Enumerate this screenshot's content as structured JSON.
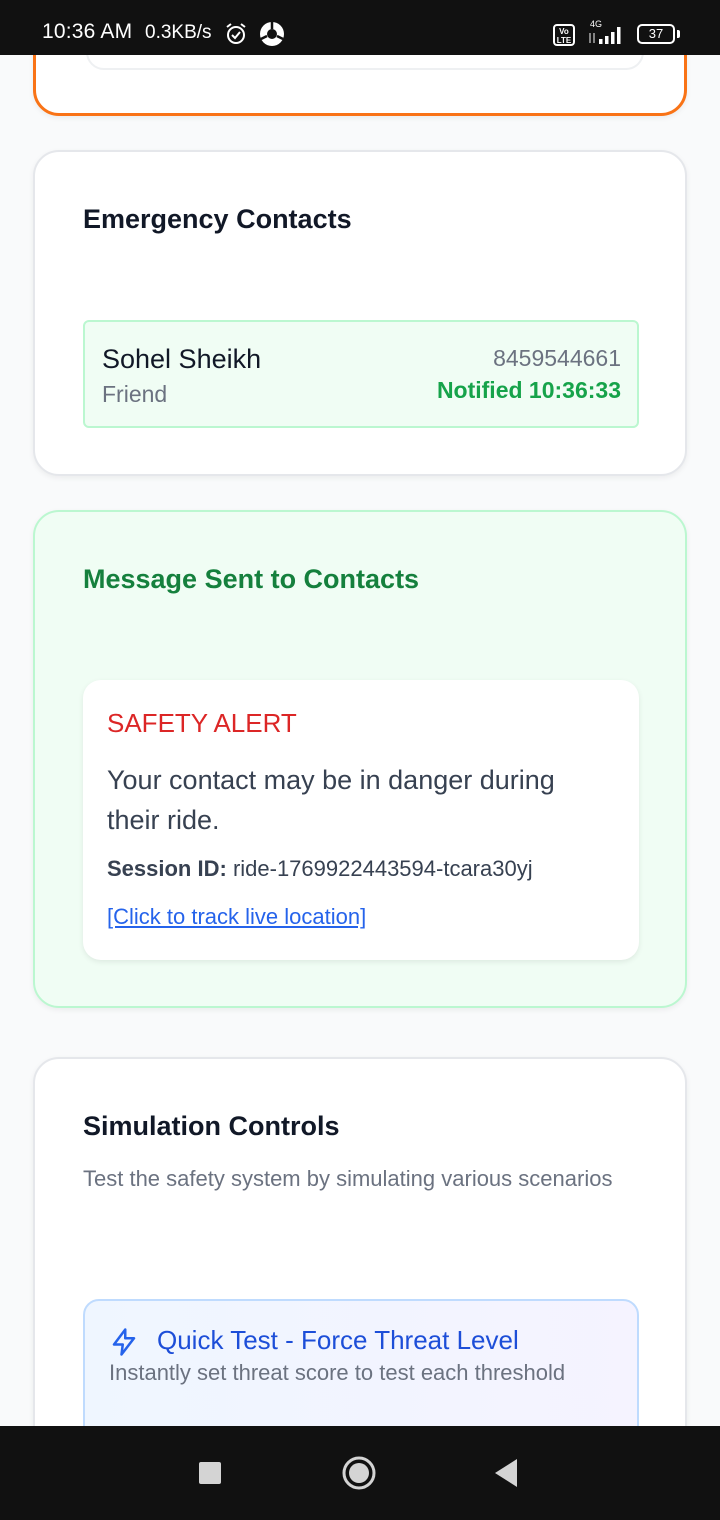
{
  "status_bar": {
    "time": "10:36 AM",
    "speed": "0.3KB/s",
    "network": "4G",
    "volte": "Vo LTE",
    "battery": "37"
  },
  "emergency_contacts": {
    "title": "Emergency Contacts",
    "contacts": [
      {
        "name": "Sohel Sheikh",
        "relation": "Friend",
        "phone": "8459544661",
        "status": "Notified 10:36:33"
      }
    ]
  },
  "message_sent": {
    "title": "Message Sent to Contacts",
    "alert_heading": "SAFETY ALERT",
    "alert_body": "Your contact may be in danger during their ride.",
    "session_label": "Session ID:",
    "session_id": "ride-1769922443594-tcara30yj",
    "track_link": "[Click to track live location]"
  },
  "simulation_controls": {
    "title": "Simulation Controls",
    "description": "Test the safety system by simulating various scenarios",
    "quick_test": {
      "icon": "lightning-bolt-icon",
      "title": "Quick Test - Force Threat Level",
      "description": "Instantly set threat score to test each threshold"
    }
  },
  "colors": {
    "accent_orange": "#f97316",
    "success_green": "#16a34a",
    "alert_red": "#dc2626",
    "link_blue": "#2563eb"
  }
}
